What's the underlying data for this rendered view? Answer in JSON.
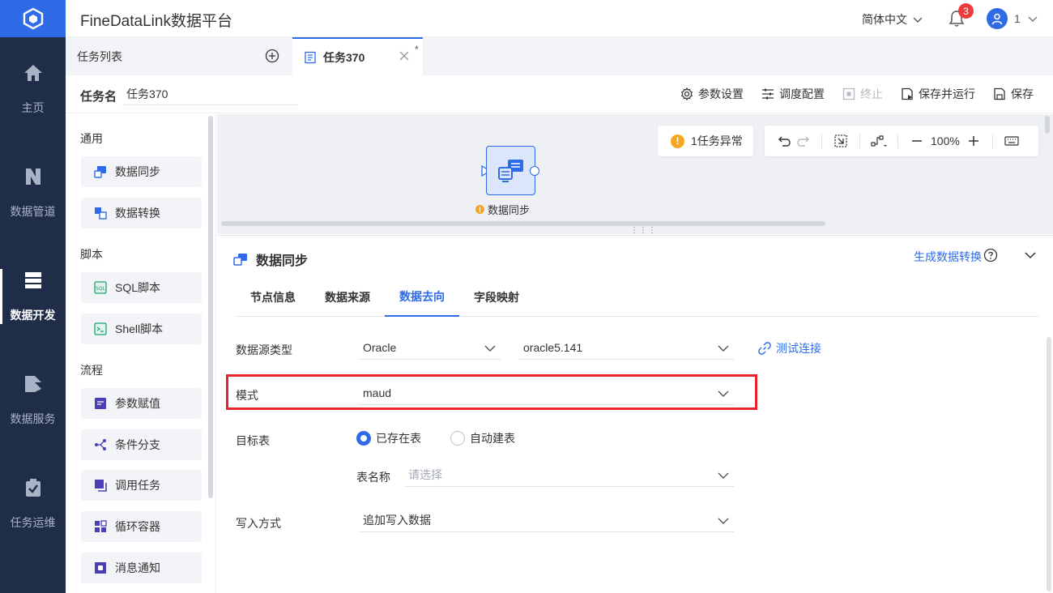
{
  "app": {
    "title": "FineDataLink数据平台"
  },
  "header": {
    "language": "简体中文",
    "notification_count": "3",
    "user_name": "1"
  },
  "nav": {
    "items": [
      {
        "label": "主页",
        "icon": "home-icon"
      },
      {
        "label": "数据管道",
        "icon": "pipeline-icon"
      },
      {
        "label": "数据开发",
        "icon": "dev-icon",
        "active": true
      },
      {
        "label": "数据服务",
        "icon": "service-icon"
      },
      {
        "label": "任务运维",
        "icon": "ops-icon"
      }
    ]
  },
  "tabs": {
    "list_label": "任务列表",
    "active_label": "任务370",
    "modified_mark": "*"
  },
  "task": {
    "name_label": "任务名",
    "name_value": "任务370"
  },
  "toolbar": {
    "param_settings": "参数设置",
    "schedule_config": "调度配置",
    "stop": "终止",
    "save_and_run": "保存并运行",
    "save": "保存"
  },
  "palette": {
    "groups": [
      {
        "title": "通用",
        "items": [
          "数据同步",
          "数据转换"
        ]
      },
      {
        "title": "脚本",
        "items": [
          "SQL脚本",
          "Shell脚本"
        ]
      },
      {
        "title": "流程",
        "items": [
          "参数赋值",
          "条件分支",
          "调用任务",
          "循环容器",
          "消息通知"
        ]
      }
    ]
  },
  "canvas": {
    "exception_text": "1任务异常",
    "zoom": "100%",
    "node_label": "数据同步"
  },
  "panel": {
    "title": "数据同步",
    "generate_link": "生成数据转换",
    "tabs": [
      "节点信息",
      "数据来源",
      "数据去向",
      "字段映射"
    ],
    "active_tab": "数据去向",
    "form": {
      "datasource_type_label": "数据源类型",
      "datasource_type_value": "Oracle",
      "connection_value": "oracle5.141",
      "test_connection": "测试连接",
      "schema_label": "模式",
      "schema_value": "maud",
      "target_table_label": "目标表",
      "radio_existing": "已存在表",
      "radio_auto": "自动建表",
      "table_name_label": "表名称",
      "table_name_placeholder": "请选择",
      "write_mode_label": "写入方式",
      "write_mode_value": "追加写入数据"
    }
  },
  "colors": {
    "accent": "#2f6be6",
    "nav_bg": "#1f2d48",
    "highlight_border": "#e8232b",
    "warning": "#f5a623"
  }
}
